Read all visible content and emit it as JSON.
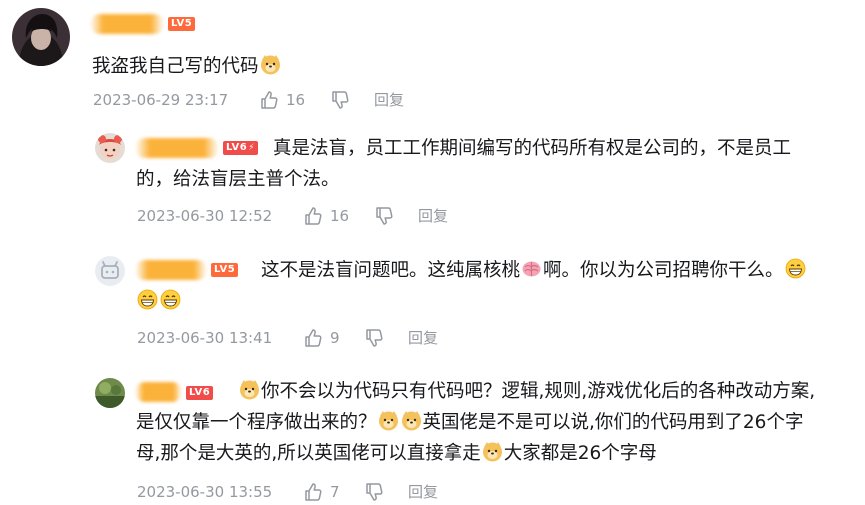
{
  "comments": [
    {
      "level": "LV5",
      "line1": "我盗我自己写的代码",
      "time": "2023-06-29 23:17",
      "likes": "16",
      "reply": "回复"
    },
    {
      "level": "LV6",
      "line1": "真是法盲，员工工作期间编写的代码所有权是公司的，不是员工",
      "line2": "的，给法盲层主普个法。",
      "time": "2023-06-30 12:52",
      "likes": "16",
      "reply": "回复"
    },
    {
      "level": "LV5",
      "line1a": "这不是法盲问题吧。这纯属核桃",
      "line1b": "啊。你以为公司招聘你干么。",
      "time": "2023-06-30 13:41",
      "likes": "9",
      "reply": "回复"
    },
    {
      "level": "LV6",
      "line1": "你不会以为代码只有代码吧？逻辑,规则,游戏优化后的各种改动方案,",
      "line2a": "是仅仅靠一个程序做出来的？",
      "line2b": "英国佬是不是可以说,你们的代码用到了26个字",
      "line3a": "母,那个是大英的,所以英国佬可以直接拿走",
      "line3b": "大家都是26个字母",
      "time": "2023-06-30 13:55",
      "likes": "7",
      "reply": "回复"
    }
  ],
  "icons": {
    "like": "thumbs-up-icon",
    "dislike": "thumbs-down-icon",
    "emoji_doge": "doge-emoji-icon",
    "emoji_grin": "grinning-emoji-icon",
    "emoji_brain": "brain-emoji-icon"
  },
  "colors": {
    "text": "#18191c",
    "meta": "#9499a0",
    "level_badge": "#ff6a3d",
    "redacted_name": "#fbb23a"
  }
}
